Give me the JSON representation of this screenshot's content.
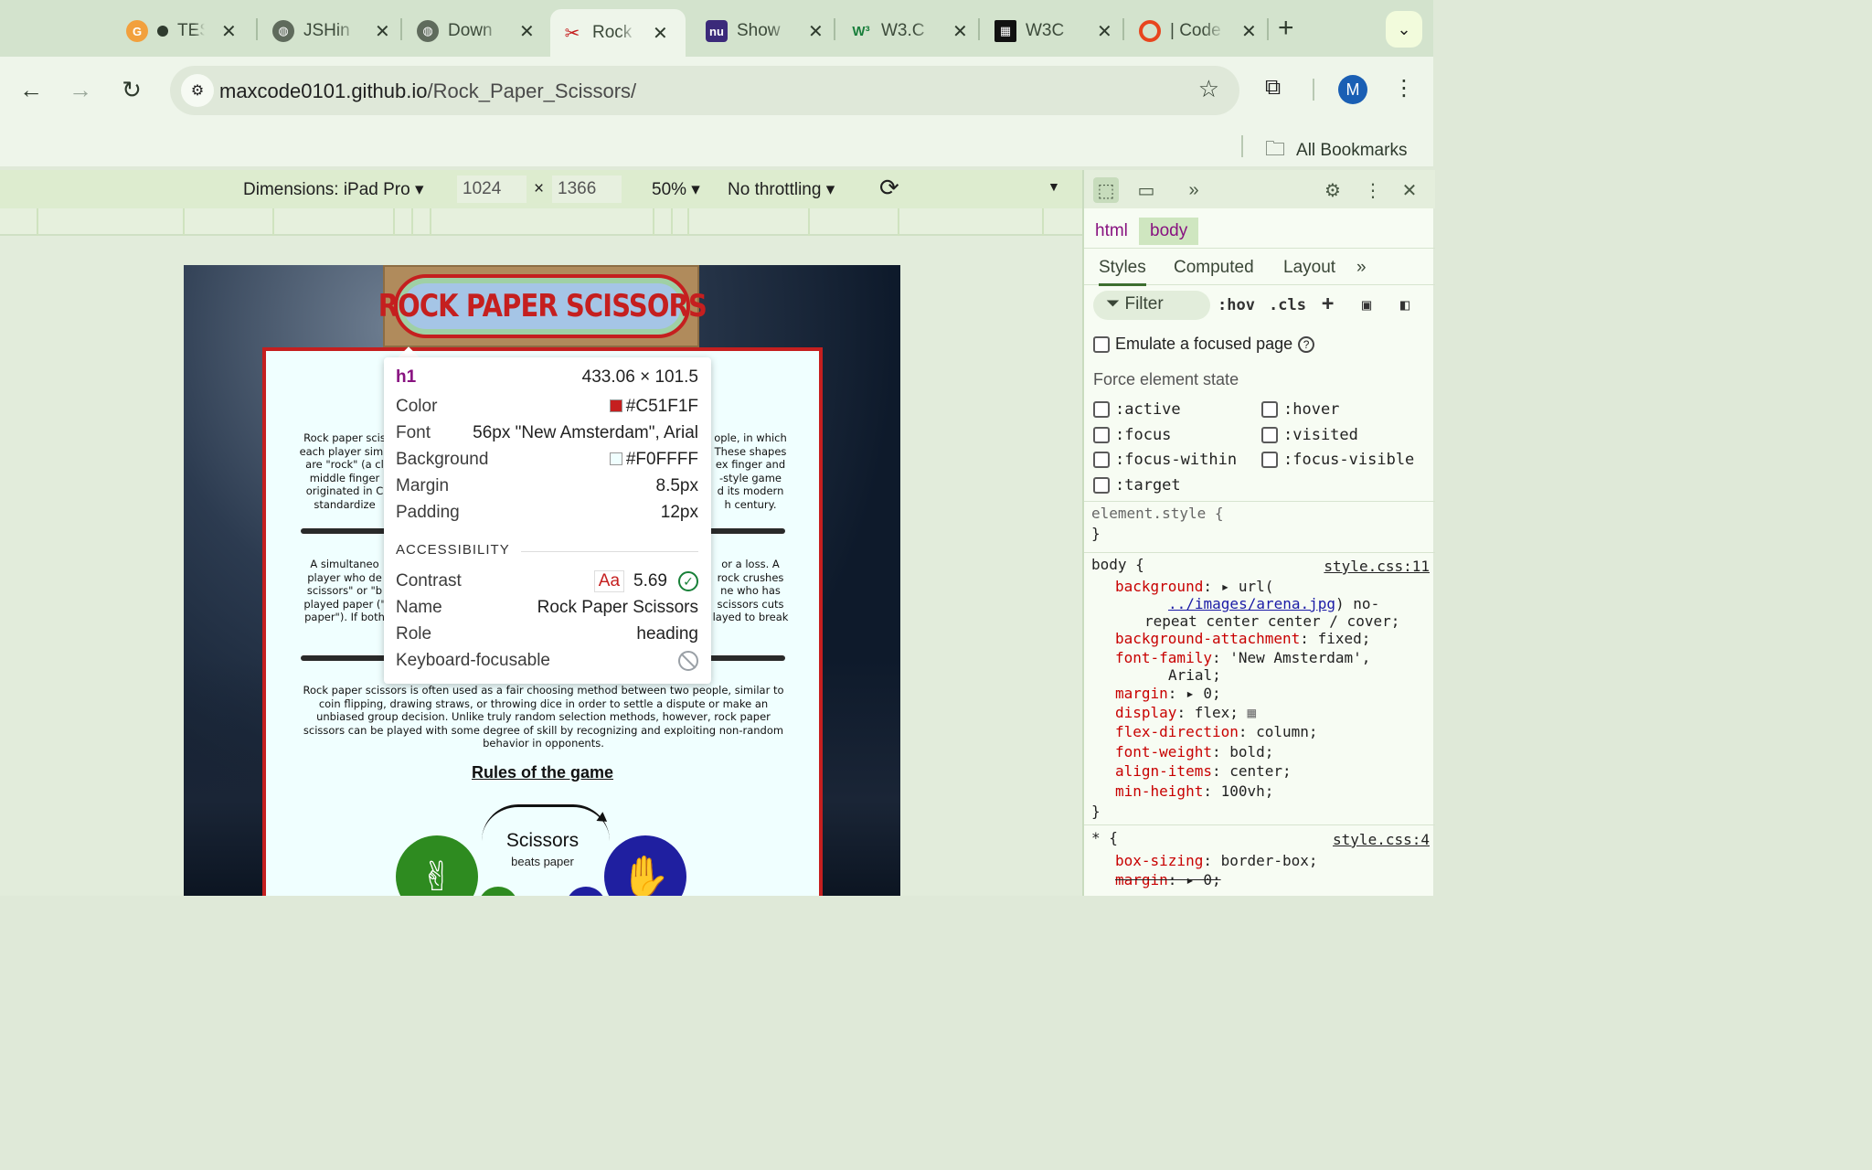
{
  "tabs": [
    {
      "title": "TES",
      "favicon": "G",
      "color": "#f2a03d"
    },
    {
      "title": "JSHin",
      "favicon": "globe",
      "color": "#5f6b5c"
    },
    {
      "title": "Down",
      "favicon": "globe",
      "color": "#5f6b5c"
    },
    {
      "title": "Rock",
      "favicon": "scissors",
      "color": "#c51f1f"
    },
    {
      "title": "Show",
      "favicon": "nu",
      "color": "#3b2a7a"
    },
    {
      "title": "W3.C",
      "favicon": "W3",
      "color": "#1a7f3c"
    },
    {
      "title": "W3C",
      "favicon": "img",
      "color": "#111111"
    },
    {
      "title": "| Code",
      "favicon": "ring",
      "color": "#e8451e"
    }
  ],
  "address": {
    "host": "maxcode0101.github.io",
    "path": "/Rock_Paper_Scissors/"
  },
  "profile_initial": "M",
  "bookmarks_label": "All Bookmarks",
  "device_toolbar": {
    "dimensions": "Dimensions: iPad Pro ▾",
    "width": "1024",
    "times": "×",
    "height": "1366",
    "zoom": "50% ▾",
    "throttling": "No throttling ▾"
  },
  "page": {
    "heading": "ROCK PAPER SCISSORS",
    "para1_left": "Rock paper scis\neach player simu\nare \"rock\" (a cl\nmiddle finger\noriginated in C\nstandardize",
    "para1_right": "ople, in which\n These shapes\nex finger and\n-style game\nd its modern\nh century.",
    "para2_left": "A simultaneo\nplayer who de\nscissors\" or \"b\nplayed paper (\"\npaper\"). If both",
    "para2_right": "or a loss. A\nrock crushes\nne who has\nscissors cuts\nlayed to break",
    "para3": "Rock paper scissors is often used as a fair choosing method between two people, similar to coin flipping, drawing straws, or throwing dice in order to settle a dispute or make an unbiased group decision. Unlike truly random selection methods, however, rock paper scissors can be played with some degree of skill by recognizing and exploiting non-random behavior in opponents.",
    "rules_title": "Rules of the game",
    "scissors_label": "Scissors",
    "scissors_sub": "beats paper"
  },
  "inspect_tooltip": {
    "tag": "h1",
    "size": "433.06 × 101.5",
    "rows": [
      {
        "label": "Color",
        "value": "#C51F1F",
        "swatch": "#C51F1F"
      },
      {
        "label": "Font",
        "value": "56px \"New Amsterdam\", Arial"
      },
      {
        "label": "Background",
        "value": "#F0FFFF",
        "swatch": "#F0FFFF"
      },
      {
        "label": "Margin",
        "value": "8.5px"
      },
      {
        "label": "Padding",
        "value": "12px"
      }
    ],
    "accessibility_title": "ACCESSIBILITY",
    "contrast_label": "Contrast",
    "contrast_aa": "Aa",
    "contrast_value": "5.69",
    "name_label": "Name",
    "name_value": "Rock Paper Scissors",
    "role_label": "Role",
    "role_value": "heading",
    "focusable_label": "Keyboard-focusable"
  },
  "devtools": {
    "breadcrumbs": [
      "html",
      "body"
    ],
    "subtabs": [
      "Styles",
      "Computed",
      "Layout"
    ],
    "filter_placeholder": "Filter",
    "hov": ":hov",
    "cls": ".cls",
    "emulate_focus": "Emulate a focused page",
    "force_state_title": "Force element state",
    "states": [
      ":active",
      ":hover",
      ":focus",
      ":visited",
      ":focus-within",
      ":focus-visible",
      ":target"
    ],
    "element_style_open": "element.style {",
    "element_style_close": "}",
    "body_rule": {
      "selector": "body {",
      "source": "style.css:11",
      "decls": [
        {
          "prop": "background",
          "value": "▸ url("
        },
        {
          "prop": "",
          "value": "../images/arena.jpg",
          "link": true,
          "suffix": ") no-"
        },
        {
          "prop": "",
          "value": "repeat center center / cover;"
        },
        {
          "prop": "background-attachment",
          "value": "fixed;"
        },
        {
          "prop": "font-family",
          "value": "'New Amsterdam',"
        },
        {
          "prop": "",
          "value": "Arial;"
        },
        {
          "prop": "margin",
          "value": "▸ 0;"
        },
        {
          "prop": "display",
          "value": "flex;"
        },
        {
          "prop": "flex-direction",
          "value": "column;"
        },
        {
          "prop": "font-weight",
          "value": "bold;"
        },
        {
          "prop": "align-items",
          "value": "center;"
        },
        {
          "prop": "min-height",
          "value": "100vh;"
        }
      ],
      "close": "}"
    },
    "star_rule": {
      "selector": "* {",
      "source": "style.css:4",
      "decls": [
        {
          "prop": "box-sizing",
          "value": "border-box;"
        },
        {
          "prop": "margin",
          "value": "▸ 0;",
          "struck": true
        }
      ]
    }
  }
}
